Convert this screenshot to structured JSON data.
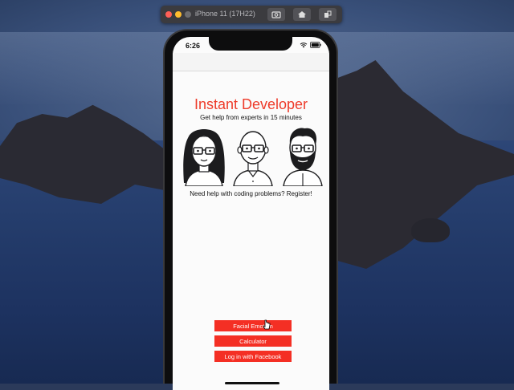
{
  "simulator": {
    "title": "iPhone 11 (17H22)",
    "buttons": [
      "screenshot-icon",
      "home-icon",
      "rotate-icon"
    ]
  },
  "status_bar": {
    "time": "6:26",
    "icons": [
      "wifi-icon",
      "battery-icon"
    ]
  },
  "app": {
    "title": "Instant Developer",
    "subtitle": "Get help from experts in 15 minutes",
    "register_text": "Need help with coding problems? Register!",
    "buttons": {
      "facial_emotion": "Facial Emotion",
      "calculator": "Calculator",
      "facebook_login": "Log in with Facebook"
    },
    "illustration": [
      "developer-avatar-woman",
      "developer-avatar-bald-man",
      "developer-avatar-bearded-man"
    ]
  },
  "colors": {
    "accent": "#ee3b2a",
    "button": "#f42f24"
  }
}
